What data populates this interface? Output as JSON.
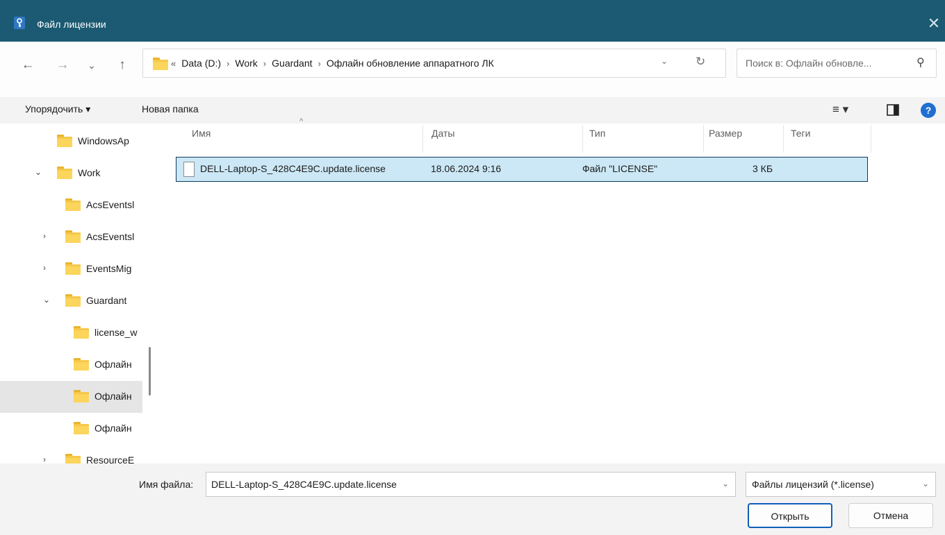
{
  "window": {
    "title": "Файл лицензии",
    "close_glyph": "✕"
  },
  "nav": {
    "back": "←",
    "forward": "→",
    "recent": "⌄",
    "up": "↑",
    "breadcrumb_overflow": "«",
    "breadcrumb": [
      "Data (D:)",
      "Work",
      "Guardant",
      "Офлайн обновление аппаратного ЛК"
    ],
    "breadcrumb_sep": "›",
    "search_placeholder": "Поиск в: Офлайн обновле..."
  },
  "toolbar": {
    "organize": "Упорядочить ▾",
    "new_folder": "Новая папка",
    "view_glyph": "≡ ▾",
    "help_glyph": "?"
  },
  "sidebar": {
    "items": [
      {
        "label": "WindowsAp",
        "chevron": ""
      },
      {
        "label": "Work",
        "chevron": "⌄"
      },
      {
        "label": "AcsEventsl",
        "chevron": ""
      },
      {
        "label": "AcsEventsl",
        "chevron": "›"
      },
      {
        "label": "EventsMig",
        "chevron": "›"
      },
      {
        "label": "Guardant",
        "chevron": "⌄"
      },
      {
        "label": "license_w",
        "chevron": ""
      },
      {
        "label": "Офлайн",
        "chevron": ""
      },
      {
        "label": "Офлайн",
        "chevron": "",
        "selected": true
      },
      {
        "label": "Офлайн",
        "chevron": ""
      },
      {
        "label": "ResourceE",
        "chevron": "›"
      }
    ]
  },
  "filelist": {
    "columns": [
      "Имя",
      "Даты",
      "Тип",
      "Размер",
      "Теги"
    ],
    "sort_glyph": "^",
    "rows": [
      {
        "name": "DELL-Laptop-S_428C4E9C.update.license",
        "date": "18.06.2024 9:16",
        "type": "Файл \"LICENSE\"",
        "size": "3 КБ",
        "tags": ""
      }
    ]
  },
  "footer": {
    "filename_label": "Имя файла:",
    "filename_value": "DELL-Laptop-S_428C4E9C.update.license",
    "filetype": "Файлы лицензий (*.license)",
    "dropdown_glyph": "⌄",
    "open_label": "Открыть",
    "cancel_label": "Отмена"
  },
  "colors": {
    "titlebar": "#1b5a72",
    "selection": "#cce8f6",
    "accent": "#0f5fb8",
    "folder": "#f7c84a"
  },
  "icons": [
    "key-icon",
    "close-icon",
    "back-arrow-icon",
    "forward-arrow-icon",
    "chevron-down-icon",
    "up-arrow-icon",
    "folder-icon",
    "refresh-icon",
    "search-icon",
    "view-list-icon",
    "preview-pane-icon",
    "help-icon",
    "file-icon"
  ]
}
